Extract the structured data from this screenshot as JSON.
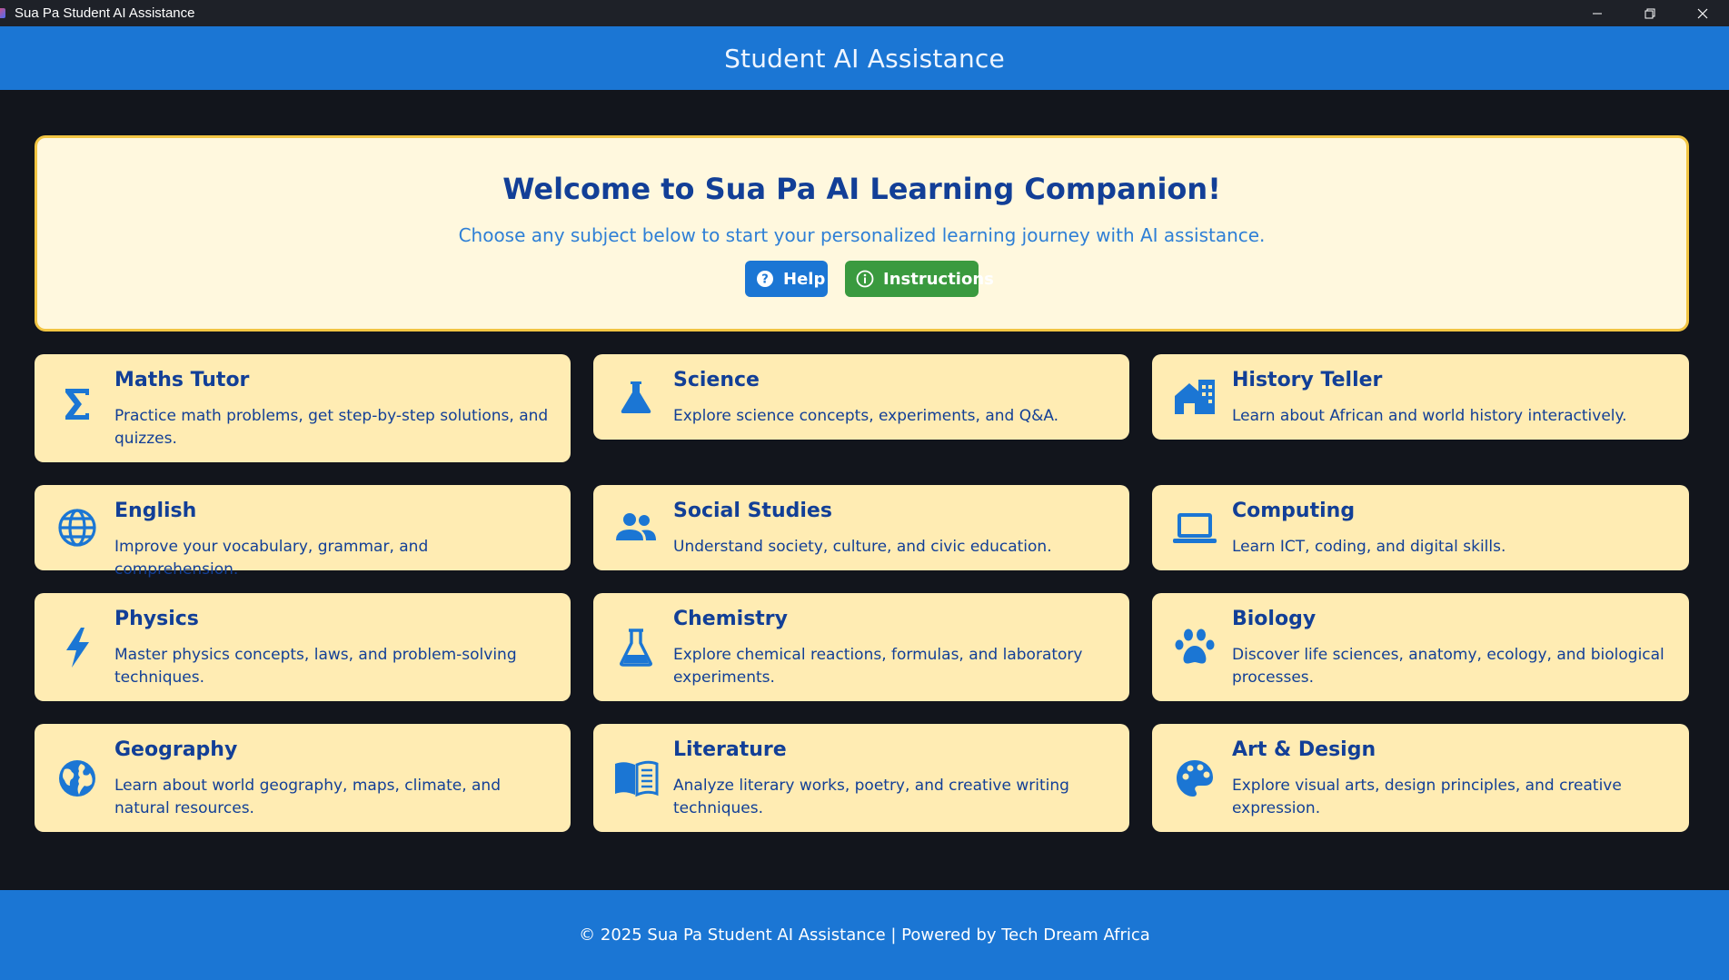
{
  "window": {
    "title": "Sua Pa Student AI Assistance",
    "controls": [
      "minimize-icon",
      "restore-icon",
      "close-icon"
    ]
  },
  "header": {
    "title": "Student AI Assistance"
  },
  "welcome": {
    "heading": "Welcome to Sua Pa AI Learning Companion!",
    "subtitle": "Choose any subject below to start your personalized learning journey with AI assistance.",
    "help_label": "Help",
    "instructions_label": "Instructions"
  },
  "subjects": [
    {
      "title": "Maths Tutor",
      "desc": "Practice math problems, get step-by-step solutions, and quizzes.",
      "icon": "sigma-icon"
    },
    {
      "title": "Science",
      "desc": "Explore science concepts, experiments, and Q&A.",
      "icon": "flask-icon"
    },
    {
      "title": "History Teller",
      "desc": "Learn about African and world history interactively.",
      "icon": "building-icon"
    },
    {
      "title": "English",
      "desc": "Improve your vocabulary, grammar, and comprehension.",
      "icon": "globe-icon"
    },
    {
      "title": "Social Studies",
      "desc": "Understand society, culture, and civic education.",
      "icon": "people-icon"
    },
    {
      "title": "Computing",
      "desc": "Learn ICT, coding, and digital skills.",
      "icon": "laptop-icon"
    },
    {
      "title": "Physics",
      "desc": "Master physics concepts, laws, and problem-solving techniques.",
      "icon": "lightning-icon"
    },
    {
      "title": "Chemistry",
      "desc": "Explore chemical reactions, formulas, and laboratory experiments.",
      "icon": "beaker-icon"
    },
    {
      "title": "Biology",
      "desc": "Discover life sciences, anatomy, ecology, and biological processes.",
      "icon": "paw-icon"
    },
    {
      "title": "Geography",
      "desc": "Learn about world geography, maps, climate, and natural resources.",
      "icon": "earth-icon"
    },
    {
      "title": "Literature",
      "desc": "Analyze literary works, poetry, and creative writing techniques.",
      "icon": "book-icon"
    },
    {
      "title": "Art & Design",
      "desc": "Explore visual arts, design principles, and creative expression.",
      "icon": "palette-icon"
    }
  ],
  "footer": {
    "text": "© 2025 Sua Pa Student AI Assistance | Powered by Tech Dream Africa"
  },
  "colors": {
    "primary": "#1b76d4",
    "success": "#3a9a3f",
    "card_bg": "#ffecb3",
    "welcome_bg": "#fff8de",
    "welcome_border": "#f2c542",
    "heading_text": "#123f97",
    "page_bg": "#12151c"
  }
}
